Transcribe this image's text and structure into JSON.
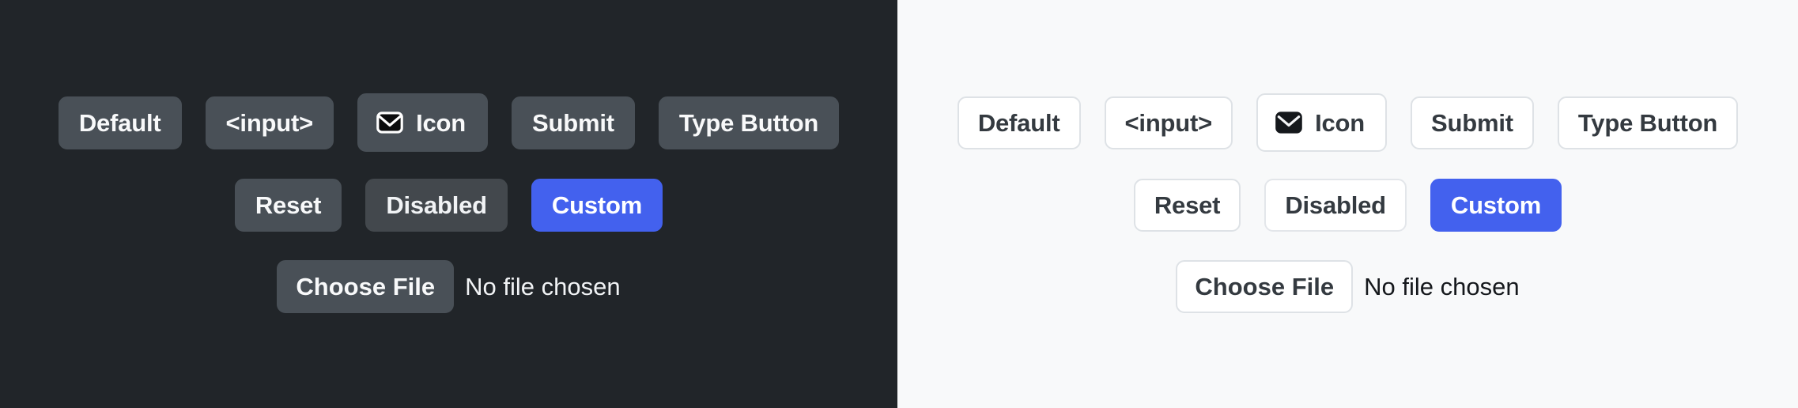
{
  "theme": {
    "dark": {
      "name": "dark",
      "background": "#212529",
      "button_bg": "#495057",
      "button_text": "#f8f9fa",
      "disabled_bg": "#43484d",
      "file_text": "#f1f3f5"
    },
    "light": {
      "name": "light",
      "background": "#f8f9fa",
      "button_bg": "#ffffff",
      "button_border": "#dee2e6",
      "button_text": "#343a40",
      "file_text": "#15181c"
    },
    "accent": "#4361ee"
  },
  "buttons": {
    "row1": [
      {
        "label": "Default",
        "name": "default-button"
      },
      {
        "label": "<input>",
        "name": "input-button"
      },
      {
        "label": "Icon",
        "name": "icon-button",
        "icon": "envelope-icon"
      },
      {
        "label": "Submit",
        "name": "submit-button"
      },
      {
        "label": "Type Button",
        "name": "type-button"
      }
    ],
    "row2": [
      {
        "label": "Reset",
        "name": "reset-button"
      },
      {
        "label": "Disabled",
        "name": "disabled-button",
        "state": "disabled"
      },
      {
        "label": "Custom",
        "name": "custom-button",
        "variant": "custom",
        "color": "#4361ee"
      }
    ]
  },
  "file_input": {
    "button_label": "Choose File",
    "status_text": "No file chosen"
  }
}
